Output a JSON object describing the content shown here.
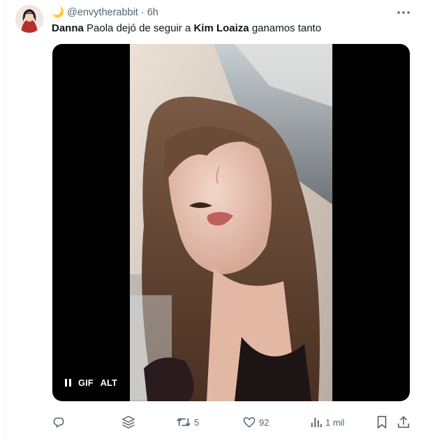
{
  "tweet": {
    "moon": "🌙",
    "handle": "@envytherabbit",
    "separator": "·",
    "time": "6h",
    "text": [
      {
        "t": "Danna",
        "bold": true
      },
      {
        "t": " Paola dejó de seguir a ",
        "bold": false
      },
      {
        "t": "Kim Loaiza",
        "bold": true
      },
      {
        "t": " ganamos tanto",
        "bold": false
      }
    ]
  },
  "media": {
    "gif_label": "GIF",
    "alt_label": "ALT"
  },
  "actions": {
    "reply_count": "",
    "retweet_count": "5",
    "like_count": "92",
    "views_count": "1 mil"
  },
  "colors": {
    "muted": "#536471",
    "text": "#0f1419",
    "media_bg": "#000000"
  },
  "icons": [
    "more-icon",
    "reply-icon",
    "grok-icon",
    "retweet-icon",
    "like-icon",
    "views-icon",
    "bookmark-icon",
    "share-icon",
    "pause-icon"
  ]
}
